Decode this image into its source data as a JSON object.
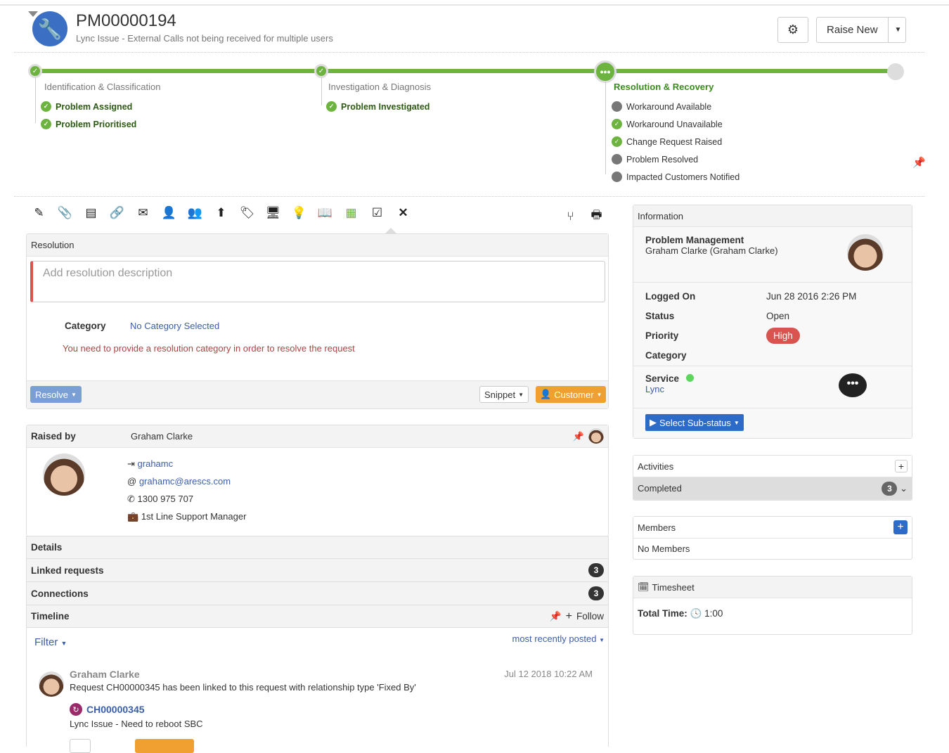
{
  "header": {
    "id": "PM00000194",
    "summary": "Lync Issue - External Calls not being received for multiple users",
    "raise_new": "Raise New"
  },
  "progress": {
    "stages": [
      {
        "label": "Identification & Classification",
        "milestones": [
          {
            "label": "Problem Assigned",
            "done": true
          },
          {
            "label": "Problem Prioritised",
            "done": true
          }
        ]
      },
      {
        "label": "Investigation & Diagnosis",
        "milestones": [
          {
            "label": "Problem Investigated",
            "done": true
          }
        ]
      },
      {
        "label": "Resolution & Recovery",
        "milestones": [
          {
            "label": "Workaround Available",
            "done": false
          },
          {
            "label": "Workaround Unavailable",
            "done": true
          },
          {
            "label": "Change Request Raised",
            "done": true
          },
          {
            "label": "Problem Resolved",
            "done": false
          },
          {
            "label": "Impacted Customers Notified",
            "done": false
          }
        ]
      }
    ]
  },
  "toolbar": {
    "icons": [
      "edit-icon",
      "attachment-icon",
      "notes-icon",
      "link-icon",
      "email-icon",
      "add-user-icon",
      "users-icon",
      "escalate-icon",
      "tags-icon",
      "monitor-icon",
      "lightbulb-icon",
      "book-icon",
      "board-icon",
      "checkbox-icon",
      "close-icon",
      "branch-icon",
      "print-icon"
    ]
  },
  "resolution": {
    "title": "Resolution",
    "placeholder": "Add resolution description",
    "category_label": "Category",
    "category_value": "No Category Selected",
    "warning": "You need to provide a resolution category in order to resolve the request",
    "resolve": "Resolve",
    "snippet": "Snippet",
    "customer": "Customer"
  },
  "raised_by": {
    "label": "Raised by",
    "name": "Graham Clarke",
    "username": "grahamc",
    "email": "grahamc@arescs.com",
    "phone": "1300 975 707",
    "job": "1st Line Support Manager"
  },
  "sections": {
    "details": "Details",
    "linked": "Linked requests",
    "linked_count": "3",
    "connections": "Connections",
    "connections_count": "3",
    "timeline": "Timeline",
    "follow": "Follow"
  },
  "timeline": {
    "filter": "Filter",
    "sort": "most recently posted",
    "entry": {
      "author": "Graham Clarke",
      "time": "Jul 12 2018 10:22 AM",
      "text": "Request CH00000345 has been linked to this request with relationship type 'Fixed By'",
      "ref": "CH00000345",
      "ref_summary": "Lync Issue - Need to reboot SBC"
    }
  },
  "info": {
    "title": "Information",
    "service_name": "Problem Management",
    "owner": "Graham Clarke (Graham Clarke)",
    "logged_on_label": "Logged On",
    "logged_on": "Jun 28 2016 2:26 PM",
    "status_label": "Status",
    "status": "Open",
    "priority_label": "Priority",
    "priority": "High",
    "priority_color": "#d9534f",
    "category_label": "Category",
    "service_label": "Service",
    "service": "Lync",
    "substatus": "Select Sub-status"
  },
  "activities": {
    "title": "Activities",
    "completed": "Completed",
    "count": "3"
  },
  "members": {
    "title": "Members",
    "empty": "No Members"
  },
  "timesheet": {
    "title": "Timesheet",
    "total_label": "Total Time:",
    "total": "1:00"
  },
  "colors": {
    "green": "#6cb33f",
    "accent": "#2d6bc9",
    "orange": "#f0a030"
  }
}
